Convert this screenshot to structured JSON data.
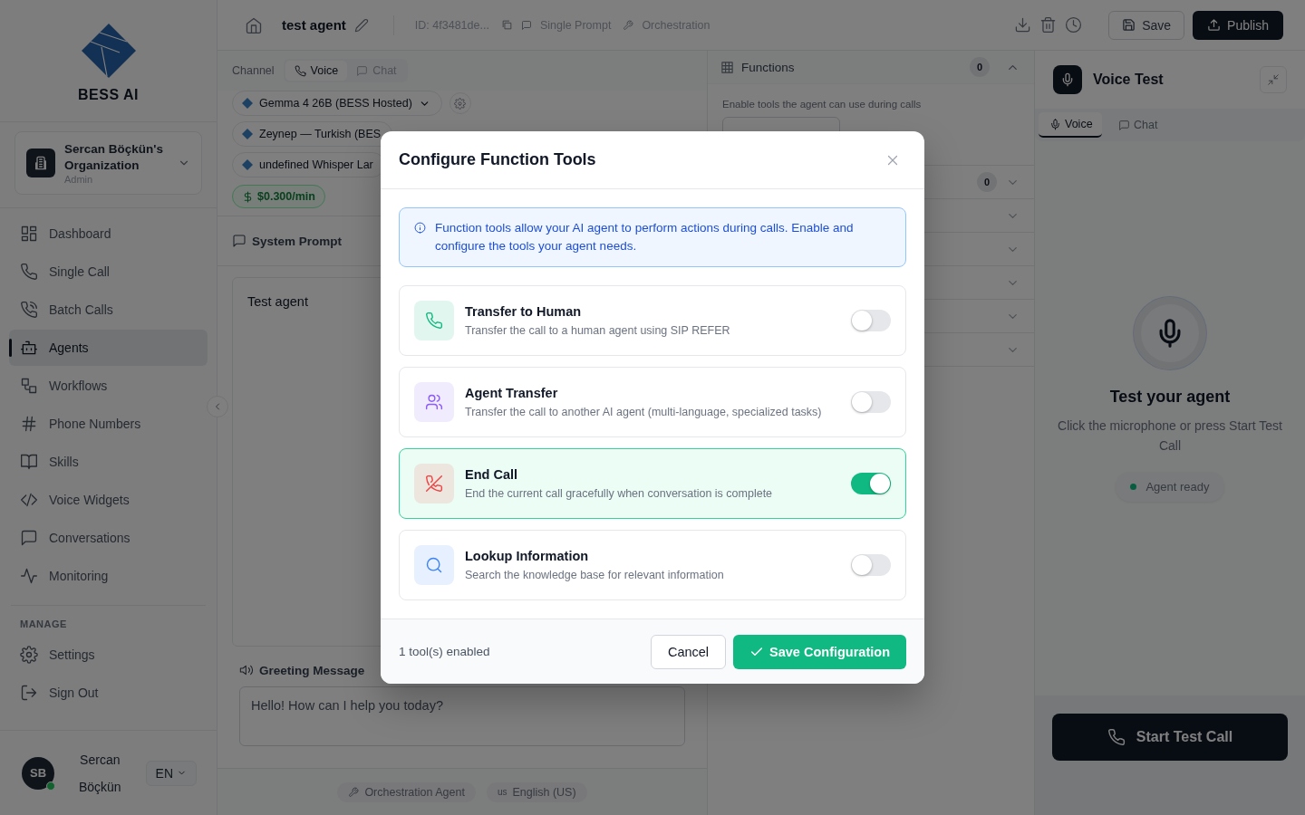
{
  "sidebar": {
    "brand": "BESS AI",
    "organization": {
      "name": "Sercan Böçkün's Organization",
      "role": "Admin"
    },
    "nav": [
      {
        "label": "Dashboard",
        "selected": false
      },
      {
        "label": "Single Call",
        "selected": false
      },
      {
        "label": "Batch Calls",
        "selected": false
      },
      {
        "label": "Agents",
        "selected": true
      },
      {
        "label": "Workflows",
        "selected": false
      },
      {
        "label": "Phone Numbers",
        "selected": false
      },
      {
        "label": "Skills",
        "selected": false
      },
      {
        "label": "Voice Widgets",
        "selected": false
      },
      {
        "label": "Conversations",
        "selected": false
      },
      {
        "label": "Monitoring",
        "selected": false
      }
    ],
    "manage_heading": "MANAGE",
    "manage": [
      {
        "label": "Settings"
      },
      {
        "label": "Sign Out"
      }
    ],
    "user": {
      "initials": "SB",
      "name": "Sercan Böçkün",
      "online": true,
      "language": "EN"
    }
  },
  "header": {
    "title": "test agent",
    "id": "ID: 4f3481de...",
    "tags": [
      "Single Prompt",
      "Orchestration"
    ],
    "save": "Save",
    "publish": "Publish"
  },
  "editor": {
    "channel_label": "Channel",
    "channels": [
      {
        "label": "Voice",
        "selected": true
      },
      {
        "label": "Chat",
        "selected": false
      }
    ],
    "models": [
      "Gemma 4 26B (BESS Hosted)",
      "Zeynep — Turkish (BES",
      "undefined Whisper Lar"
    ],
    "price": "$0.300/min",
    "system_prompt": {
      "title": "System Prompt",
      "text": "Test agent"
    },
    "greeting": {
      "title": "Greeting Message",
      "text": "Hello! How can I help you today?"
    },
    "chips": [
      {
        "label": "Orchestration Agent"
      },
      {
        "flag": "us",
        "label": "English (US)"
      }
    ]
  },
  "functions": {
    "title": "Functions",
    "count": "0",
    "expanded": true,
    "hint": "Enable tools the agent can use during calls",
    "sections": [
      {
        "count": "0",
        "expanded": false
      },
      {
        "expanded": false
      },
      {
        "expanded": false
      },
      {
        "expanded": false
      },
      {
        "expanded": false
      },
      {
        "expanded": false
      }
    ]
  },
  "voice_test": {
    "title": "Voice Test",
    "tabs": [
      {
        "label": "Voice",
        "selected": true
      },
      {
        "label": "Chat",
        "selected": false
      }
    ],
    "heading": "Test your agent",
    "text": "Click the microphone or press Start Test Call",
    "status": "Agent ready",
    "start_button": "Start Test Call"
  },
  "modal": {
    "title": "Configure Function Tools",
    "info": "Function tools allow your AI agent to perform actions during calls. Enable and configure the tools your agent needs.",
    "tools": [
      {
        "name": "Transfer to Human",
        "description": "Transfer the call to a human agent using SIP REFER",
        "color": "#10b981",
        "on": false
      },
      {
        "name": "Agent Transfer",
        "description": "Transfer the call to another AI agent (multi-language, specialized tasks)",
        "color": "#8b5cf6",
        "on": false
      },
      {
        "name": "End Call",
        "description": "End the current call gracefully when conversation is complete",
        "color": "#ef4444",
        "on": true
      },
      {
        "name": "Lookup Information",
        "description": "Search the knowledge base for relevant information",
        "color": "#3b82f6",
        "on": false
      }
    ],
    "summary": "1 tool(s) enabled",
    "cancel": "Cancel",
    "save": "Save Configuration"
  }
}
